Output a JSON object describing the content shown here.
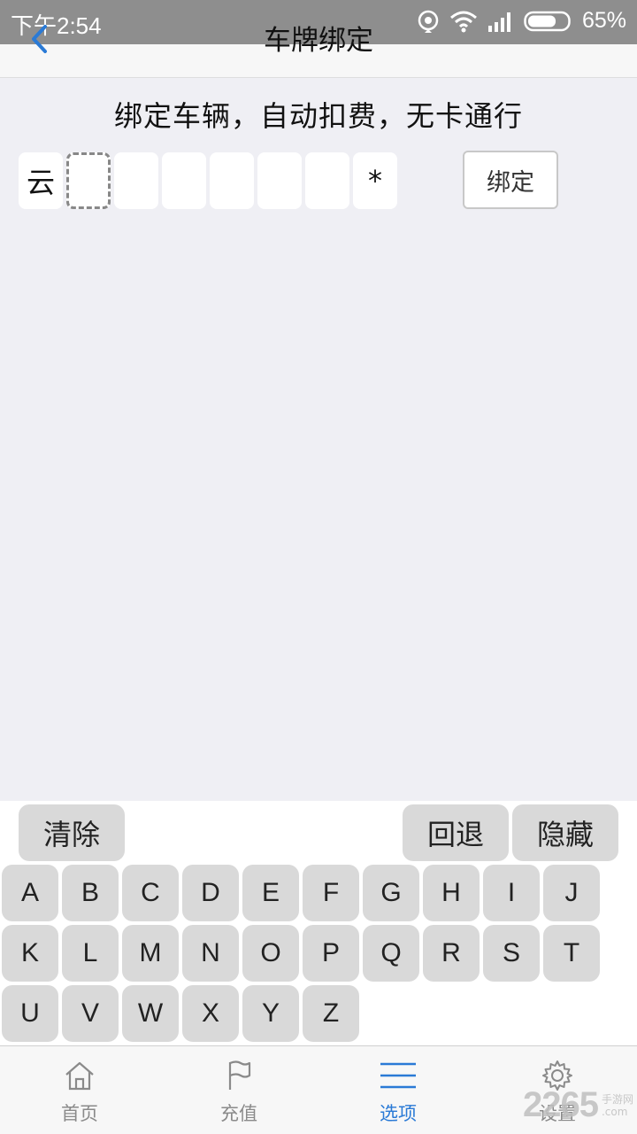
{
  "status_bar": {
    "time": "下午2:54",
    "battery": "65%"
  },
  "header": {
    "title": "车牌绑定"
  },
  "main": {
    "subtitle": "绑定车辆，自动扣费，无卡通行",
    "plate": [
      "云",
      "",
      "",
      "",
      "",
      "",
      "",
      "*"
    ],
    "bind_label": "绑定"
  },
  "keyboard": {
    "clear": "清除",
    "backspace": "回退",
    "hide": "隐藏",
    "rows": [
      [
        "A",
        "B",
        "C",
        "D",
        "E",
        "F",
        "G",
        "H",
        "I",
        "J"
      ],
      [
        "K",
        "L",
        "M",
        "N",
        "O",
        "P",
        "Q",
        "R",
        "S",
        "T"
      ],
      [
        "U",
        "V",
        "W",
        "X",
        "Y",
        "Z"
      ]
    ]
  },
  "bottom_nav": [
    {
      "label": "首页",
      "icon": "home-icon"
    },
    {
      "label": "充值",
      "icon": "flag-icon"
    },
    {
      "label": "选项",
      "icon": "menu-icon",
      "active": true
    },
    {
      "label": "设置",
      "icon": "gear-icon"
    }
  ],
  "watermark": {
    "number": "2265",
    "cn": "手游网",
    "suffix": ".com"
  },
  "colors": {
    "accent": "#2a7ad6",
    "statusbar": "#8e8e8e",
    "background": "#efeff4",
    "key": "#d9d9d9"
  }
}
